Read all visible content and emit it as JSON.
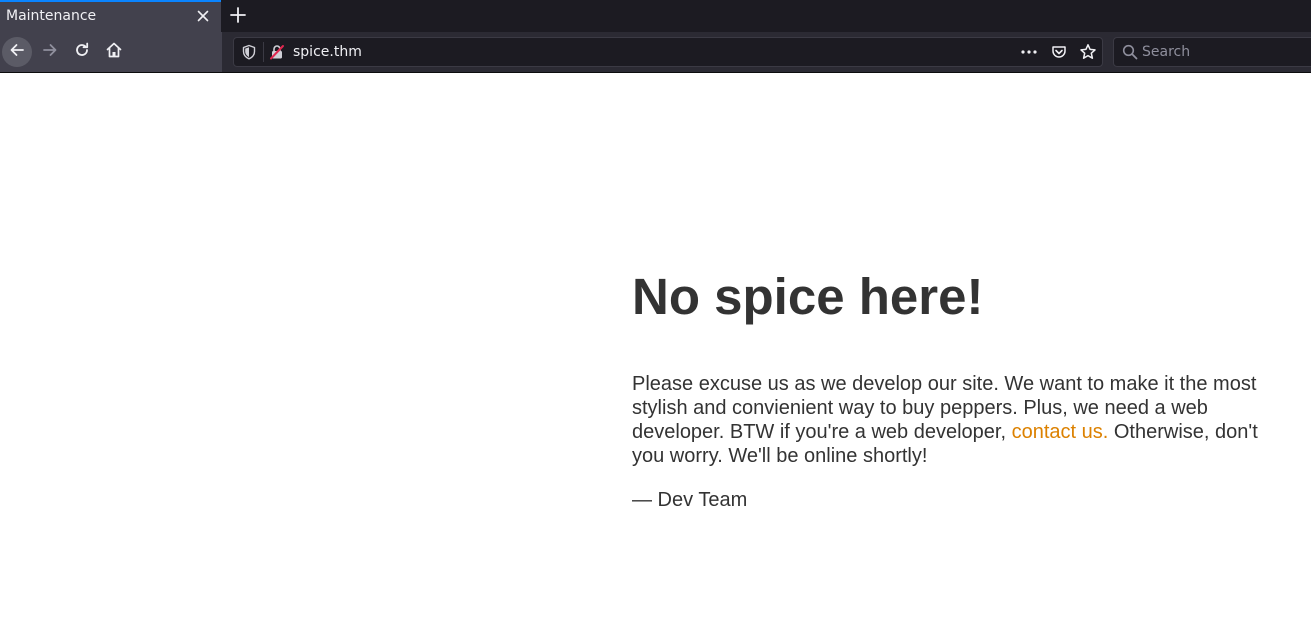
{
  "browser": {
    "tab": {
      "title": "Maintenance"
    },
    "urlbar": {
      "url": "spice.thm"
    },
    "search": {
      "placeholder": "Search"
    },
    "icons": {
      "tab_close": "close-icon",
      "new_tab": "plus-icon",
      "back": "arrow-left-icon",
      "forward": "arrow-right-icon",
      "reload": "reload-icon",
      "home": "home-icon",
      "tracking": "shield-icon",
      "security": "insecure-lock-icon",
      "page_actions": "more-icon",
      "pocket": "pocket-icon",
      "bookmark": "star-icon",
      "search": "search-icon"
    },
    "colors": {
      "accent": "#0a84ff",
      "link": "#dc8100",
      "text": "#333333"
    }
  },
  "page": {
    "heading": "No spice here!",
    "message_before_link": "Please excuse us as we develop our site. We want to make it the most stylish and convienient way to buy peppers. Plus, we need a web developer. BTW if you're a web developer, ",
    "link_text": "contact us.",
    "message_after_link": " Otherwise, don't you worry. We'll be online shortly!",
    "signature": "— Dev Team"
  }
}
